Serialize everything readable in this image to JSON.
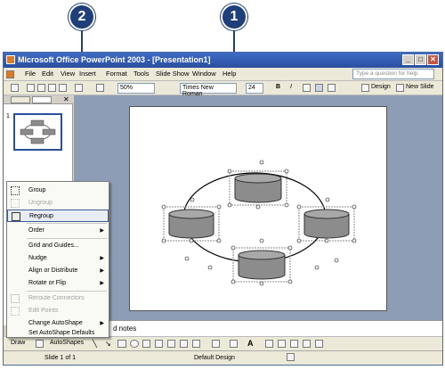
{
  "callouts": [
    {
      "label": "1"
    },
    {
      "label": "2"
    }
  ],
  "window": {
    "title": "Microsoft Office PowerPoint 2003 - [Presentation1]",
    "controls": {
      "minimize": "_",
      "maximize": "□",
      "close": "✕"
    }
  },
  "menu": {
    "items": [
      "File",
      "Edit",
      "View",
      "Insert",
      "Format",
      "Tools",
      "Slide Show",
      "Window",
      "Help"
    ],
    "help_placeholder": "Type a question for help"
  },
  "toolbar": {
    "zoom": "50%",
    "font": "Times New Roman",
    "font_size": "24",
    "bold": "B",
    "italic": "I",
    "design_label": "Design",
    "new_slide_label": "New Slide"
  },
  "slide_panel": {
    "slide_number": "1"
  },
  "notes": {
    "placeholder": "d notes"
  },
  "context_menu": {
    "items": [
      {
        "label": "Group",
        "enabled": true,
        "submenu": false
      },
      {
        "label": "Ungroup",
        "enabled": false,
        "submenu": false
      },
      {
        "label": "Regroup",
        "enabled": true,
        "submenu": false,
        "highlighted": true
      },
      {
        "label": "Order",
        "enabled": true,
        "submenu": true
      },
      {
        "label": "Grid and Guides...",
        "enabled": true,
        "submenu": false
      },
      {
        "label": "Nudge",
        "enabled": true,
        "submenu": true
      },
      {
        "label": "Align or Distribute",
        "enabled": true,
        "submenu": true
      },
      {
        "label": "Rotate or Flip",
        "enabled": true,
        "submenu": true
      },
      {
        "label": "Reroute Connectors",
        "enabled": false,
        "submenu": false
      },
      {
        "label": "Edit Points",
        "enabled": false,
        "submenu": false
      },
      {
        "label": "Change AutoShape",
        "enabled": true,
        "submenu": true
      },
      {
        "label": "Set AutoShape Defaults",
        "enabled": true,
        "submenu": false
      }
    ]
  },
  "drawbar": {
    "draw_label": "Draw",
    "autoshapes_label": "AutoShapes"
  },
  "status": {
    "slide": "Slide 1 of 1",
    "design": "Default Design"
  },
  "colors": {
    "callout": "#1f3f7a",
    "titlebar": "#2a4fa0",
    "cylinder": "#8c8c8c"
  }
}
